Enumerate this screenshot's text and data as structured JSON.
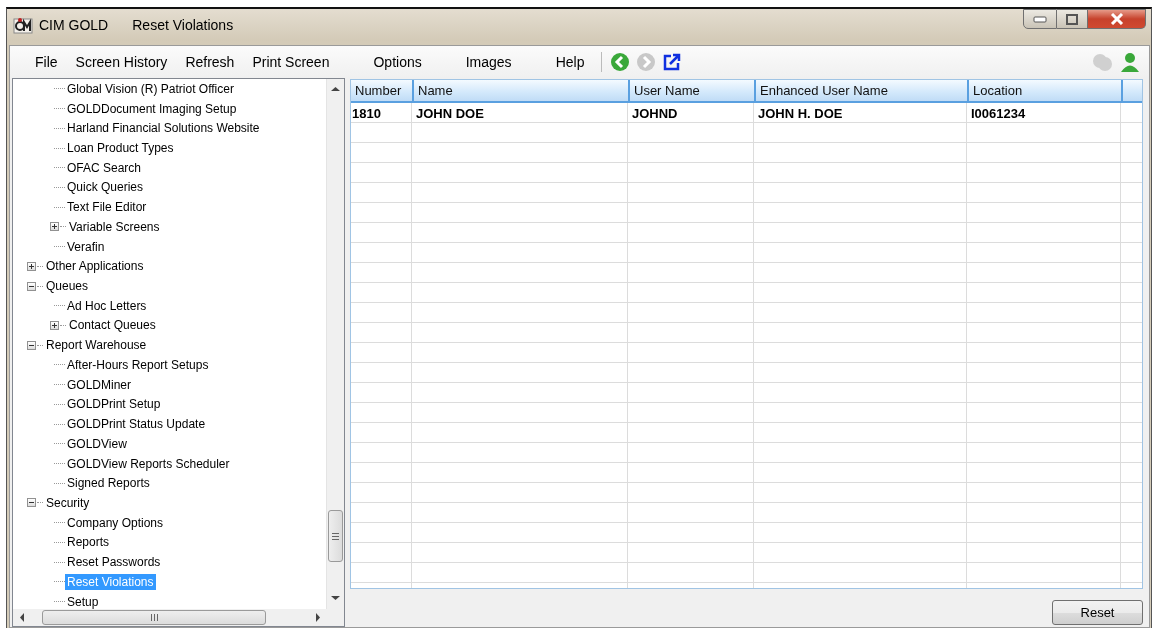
{
  "window": {
    "app_name": "CIM GOLD",
    "title": "Reset Violations"
  },
  "menu": [
    "File",
    "Screen History",
    "Refresh",
    "Print Screen",
    "Options",
    "Images",
    "Help"
  ],
  "toolbar": [
    {
      "kind": "back",
      "disabled": false
    },
    {
      "kind": "forward",
      "disabled": true
    },
    {
      "kind": "popout",
      "disabled": false
    }
  ],
  "tree": {
    "items": [
      {
        "children": [
          {
            "label": "Global Vision (R) Patriot Officer",
            "kind": "leaf",
            "selected": false
          },
          {
            "label": "GOLDDocument Imaging Setup",
            "kind": "leaf",
            "selected": false
          },
          {
            "label": "Harland Financial Solutions Website",
            "kind": "leaf",
            "selected": false
          },
          {
            "label": "Loan Product Types",
            "kind": "leaf",
            "selected": false
          },
          {
            "label": "OFAC Search",
            "kind": "leaf",
            "selected": false
          },
          {
            "label": "Quick Queries",
            "kind": "leaf",
            "selected": false
          },
          {
            "label": "Text File Editor",
            "kind": "leaf",
            "selected": false
          },
          {
            "label": "Variable Screens",
            "kind": "group",
            "expanded": false,
            "selected": false
          },
          {
            "label": "Verafin",
            "kind": "leaf",
            "selected": false
          }
        ]
      },
      {
        "label": "Other Applications",
        "kind": "group",
        "expanded": false,
        "selected": false
      },
      {
        "label": "Queues",
        "kind": "group",
        "expanded": true,
        "selected": false,
        "children": [
          {
            "label": "Ad Hoc Letters",
            "kind": "leaf",
            "selected": false
          },
          {
            "label": "Contact Queues",
            "kind": "group",
            "expanded": false,
            "selected": false
          }
        ]
      },
      {
        "label": "Report Warehouse",
        "kind": "group",
        "expanded": true,
        "selected": false,
        "children": [
          {
            "label": "After-Hours Report Setups",
            "kind": "leaf",
            "selected": false
          },
          {
            "label": "GOLDMiner",
            "kind": "leaf",
            "selected": false
          },
          {
            "label": "GOLDPrint Setup",
            "kind": "leaf",
            "selected": false
          },
          {
            "label": "GOLDPrint Status Update",
            "kind": "leaf",
            "selected": false
          },
          {
            "label": "GOLDView",
            "kind": "leaf",
            "selected": false
          },
          {
            "label": "GOLDView Reports Scheduler",
            "kind": "leaf",
            "selected": false
          },
          {
            "label": "Signed Reports",
            "kind": "leaf",
            "selected": false
          }
        ]
      },
      {
        "label": "Security",
        "kind": "group",
        "expanded": true,
        "selected": false,
        "children": [
          {
            "label": "Company Options",
            "kind": "leaf",
            "selected": false
          },
          {
            "label": "Reports",
            "kind": "leaf",
            "selected": false
          },
          {
            "label": "Reset Passwords",
            "kind": "leaf",
            "selected": false
          },
          {
            "label": "Reset Violations",
            "kind": "leaf",
            "selected": true
          },
          {
            "label": "Setup",
            "kind": "leaf",
            "selected": false
          }
        ]
      }
    ]
  },
  "table": {
    "columns": [
      "Number",
      "Name",
      "User Name",
      "Enhanced User Name",
      "Location"
    ],
    "rows": [
      [
        "1810",
        "JOHN DOE",
        "JOHND",
        "JOHN H. DOE",
        "I0061234"
      ]
    ]
  },
  "buttons": [
    "Reset"
  ]
}
